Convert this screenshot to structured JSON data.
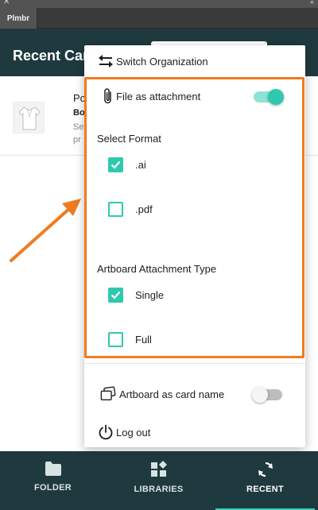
{
  "app": {
    "tab_label": "Plmbr"
  },
  "header": {
    "title": "Recent Cards"
  },
  "list": {
    "items": [
      {
        "title": "Po",
        "subtitle": "Bo",
        "desc_line1": "Se",
        "desc_line2": "pr"
      }
    ]
  },
  "menu": {
    "switch_org_label": "Switch Organization",
    "file_as_attachment_label": "File as attachment",
    "file_as_attachment_on": true,
    "select_format_label": "Select Format",
    "formats": [
      {
        "label": ".ai",
        "checked": true
      },
      {
        "label": ".pdf",
        "checked": false
      }
    ],
    "artboard_type_label": "Artboard Attachment Type",
    "artboard_types": [
      {
        "label": "Single",
        "checked": true
      },
      {
        "label": "Full",
        "checked": false
      }
    ],
    "artboard_card_name_label": "Artboard as card name",
    "artboard_card_name_on": false,
    "logout_label": "Log out"
  },
  "bottom_nav": {
    "items": [
      {
        "label": "FOLDER",
        "icon": "folder-icon",
        "active": false
      },
      {
        "label": "LIBRARIES",
        "icon": "libraries-icon",
        "active": false
      },
      {
        "label": "RECENT",
        "icon": "sync-icon",
        "active": true
      }
    ]
  },
  "colors": {
    "header_bg": "#1f3a3f",
    "accent": "#2fc8b1",
    "highlight": "#f07b1f"
  }
}
